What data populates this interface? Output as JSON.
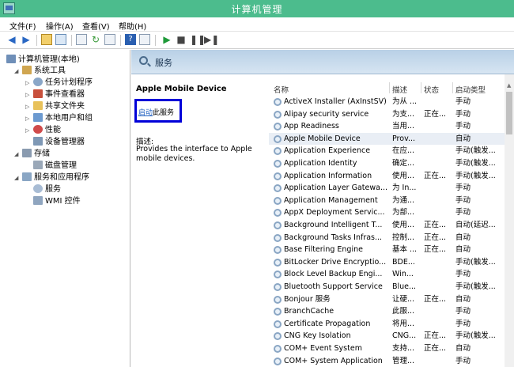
{
  "title": "计算机管理",
  "menu": [
    "文件(F)",
    "操作(A)",
    "查看(V)",
    "帮助(H)"
  ],
  "tree": [
    {
      "label": "计算机管理(本地)",
      "level": 0
    },
    {
      "label": "系统工具",
      "level": 1
    },
    {
      "label": "任务计划程序",
      "level": 2
    },
    {
      "label": "事件查看器",
      "level": 2
    },
    {
      "label": "共享文件夹",
      "level": 2
    },
    {
      "label": "本地用户和组",
      "level": 2
    },
    {
      "label": "性能",
      "level": 2
    },
    {
      "label": "设备管理器",
      "level": 2
    },
    {
      "label": "存储",
      "level": 1
    },
    {
      "label": "磁盘管理",
      "level": 2
    },
    {
      "label": "服务和应用程序",
      "level": 1
    },
    {
      "label": "服务",
      "level": 2
    },
    {
      "label": "WMI 控件",
      "level": 2
    }
  ],
  "header": {
    "title": "服务"
  },
  "detail": {
    "name": "Apple Mobile Device",
    "start_prefix": "启动",
    "start_suffix": "此服务",
    "desc_label": "描述:",
    "desc_text": "Provides the interface to Apple mobile devices."
  },
  "list": {
    "columns": [
      "名称",
      "描述",
      "状态",
      "启动类型"
    ],
    "rows": [
      {
        "name": "ActiveX Installer (AxInstSV)",
        "desc": "为从 ...",
        "status": "",
        "startup": "手动"
      },
      {
        "name": "Alipay security service",
        "desc": "为支...",
        "status": "正在...",
        "startup": "手动"
      },
      {
        "name": "App Readiness",
        "desc": "当用...",
        "status": "",
        "startup": "手动"
      },
      {
        "name": "Apple Mobile Device",
        "desc": "Prov...",
        "status": "",
        "startup": "自动"
      },
      {
        "name": "Application Experience",
        "desc": "在应...",
        "status": "",
        "startup": "手动(触发..."
      },
      {
        "name": "Application Identity",
        "desc": "确定...",
        "status": "",
        "startup": "手动(触发..."
      },
      {
        "name": "Application Information",
        "desc": "使用...",
        "status": "正在...",
        "startup": "手动(触发..."
      },
      {
        "name": "Application Layer Gatewa...",
        "desc": "为 In...",
        "status": "",
        "startup": "手动"
      },
      {
        "name": "Application Management",
        "desc": "为通...",
        "status": "",
        "startup": "手动"
      },
      {
        "name": "AppX Deployment Servic...",
        "desc": "为部...",
        "status": "",
        "startup": "手动"
      },
      {
        "name": "Background Intelligent T...",
        "desc": "使用...",
        "status": "正在...",
        "startup": "自动(延迟..."
      },
      {
        "name": "Background Tasks Infras...",
        "desc": "控制...",
        "status": "正在...",
        "startup": "自动"
      },
      {
        "name": "Base Filtering Engine",
        "desc": "基本 ...",
        "status": "正在...",
        "startup": "自动"
      },
      {
        "name": "BitLocker Drive Encryptio...",
        "desc": "BDE...",
        "status": "",
        "startup": "手动(触发..."
      },
      {
        "name": "Block Level Backup Engi...",
        "desc": "Win...",
        "status": "",
        "startup": "手动"
      },
      {
        "name": "Bluetooth Support Service",
        "desc": "Blue...",
        "status": "",
        "startup": "手动(触发..."
      },
      {
        "name": "Bonjour 服务",
        "desc": "让硬...",
        "status": "正在...",
        "startup": "自动"
      },
      {
        "name": "BranchCache",
        "desc": "此服...",
        "status": "",
        "startup": "手动"
      },
      {
        "name": "Certificate Propagation",
        "desc": "将用...",
        "status": "",
        "startup": "手动"
      },
      {
        "name": "CNG Key Isolation",
        "desc": "CNG...",
        "status": "正在...",
        "startup": "手动(触发..."
      },
      {
        "name": "COM+ Event System",
        "desc": "支持...",
        "status": "正在...",
        "startup": "自动"
      },
      {
        "name": "COM+ System Application",
        "desc": "管理...",
        "status": "",
        "startup": "手动"
      }
    ]
  }
}
